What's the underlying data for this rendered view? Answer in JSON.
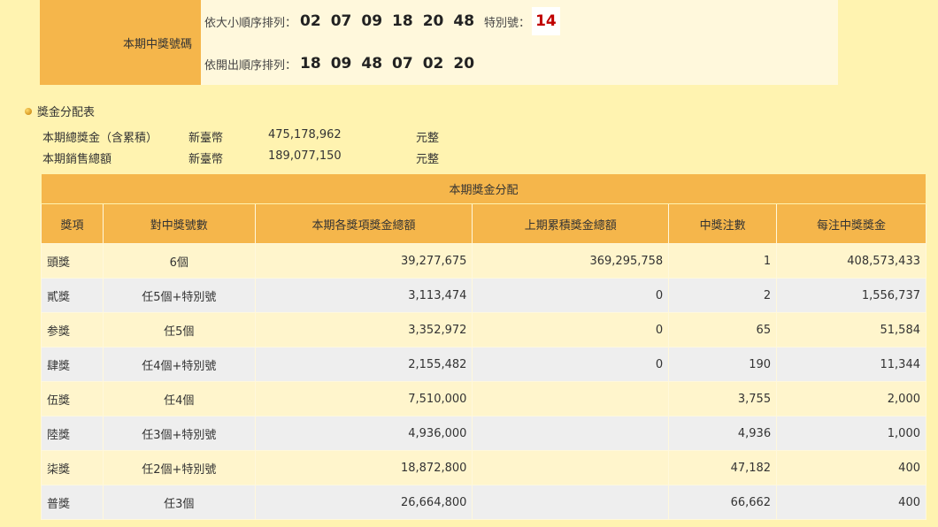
{
  "winning": {
    "label": "本期中獎號碼",
    "sorted_label": "依大小順序排列：",
    "sorted_numbers": [
      "02",
      "07",
      "09",
      "18",
      "20",
      "48"
    ],
    "special_label": "特別號：",
    "special_number": "14",
    "drawn_label": "依開出順序排列：",
    "drawn_numbers": [
      "18",
      "09",
      "48",
      "07",
      "02",
      "20"
    ]
  },
  "prize_section": {
    "title": "獎金分配表",
    "total_prize_label": "本期總獎金（含累積）",
    "total_prize_currency": "新臺幣",
    "total_prize_value": "475,178,962",
    "total_prize_unit": "元整",
    "total_sales_label": "本期銷售總額",
    "total_sales_currency": "新臺幣",
    "total_sales_value": "189,077,150",
    "total_sales_unit": "元整"
  },
  "table": {
    "caption": "本期獎金分配",
    "headers": [
      "獎項",
      "對中獎號數",
      "本期各獎項獎金總額",
      "上期累積獎金總額",
      "中獎注數",
      "每注中獎獎金"
    ],
    "rows": [
      [
        "頭獎",
        "6個",
        "39,277,675",
        "369,295,758",
        "1",
        "408,573,433"
      ],
      [
        "貳獎",
        "任5個+特別號",
        "3,113,474",
        "0",
        "2",
        "1,556,737"
      ],
      [
        "参獎",
        "任5個",
        "3,352,972",
        "0",
        "65",
        "51,584"
      ],
      [
        "肆獎",
        "任4個+特別號",
        "2,155,482",
        "0",
        "190",
        "11,344"
      ],
      [
        "伍獎",
        "任4個",
        "7,510,000",
        "",
        "3,755",
        "2,000"
      ],
      [
        "陸獎",
        "任3個+特別號",
        "4,936,000",
        "",
        "4,936",
        "1,000"
      ],
      [
        "柒獎",
        "任2個+特別號",
        "18,872,800",
        "",
        "47,182",
        "400"
      ],
      [
        "普獎",
        "任3個",
        "26,664,800",
        "",
        "66,662",
        "400"
      ]
    ]
  }
}
